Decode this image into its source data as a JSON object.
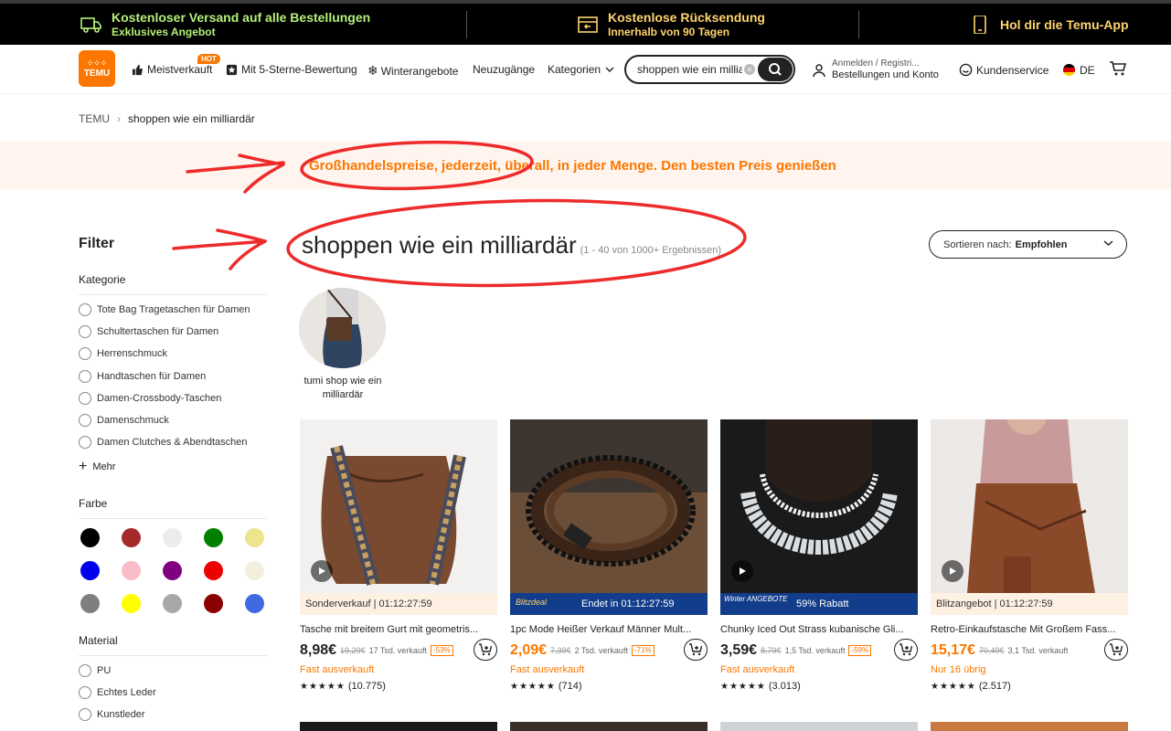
{
  "topbar": {
    "shipping_title": "Kostenloser Versand auf alle Bestellungen",
    "shipping_sub": "Exklusives Angebot",
    "return_title": "Kostenlose Rücksendung",
    "return_sub": "Innerhalb von 90 Tagen",
    "app": "Hol dir die Temu-App"
  },
  "nav": {
    "logo_top": "⁘⁘⁘",
    "logo_text": "TEMU",
    "items": {
      "bestseller": "Meistverkauft",
      "hot": "HOT",
      "fivestar": "Mit 5-Sterne-Bewertung",
      "winter": "Winterangebote",
      "new": "Neuzugänge",
      "categories": "Kategorien"
    },
    "search_value": "shoppen wie ein millia",
    "account_line1": "Anmelden / Registri...",
    "account_line2": "Bestellungen und Konto",
    "service": "Kundenservice",
    "lang": "DE"
  },
  "breadcrumb": {
    "root": "TEMU",
    "sep": "›",
    "current": "shoppen wie ein milliardär"
  },
  "banner": "Großhandelspreise, jederzeit, überall, in jeder Menge. Den besten Preis genießen",
  "filter": {
    "title": "Filter",
    "category_title": "Kategorie",
    "categories": [
      "Tote Bag Tragetaschen für Damen",
      "Schultertaschen für Damen",
      "Herrenschmuck",
      "Handtaschen für Damen",
      "Damen-Crossbody-Taschen",
      "Damenschmuck",
      "Damen Clutches & Abendtaschen"
    ],
    "more": "Mehr",
    "color_title": "Farbe",
    "colors": [
      "#000000",
      "#a52a2a",
      "#ececec",
      "#008000",
      "#ece58e",
      "#0000ee",
      "#f8bcc8",
      "#800080",
      "#ee0000",
      "#f2efdf",
      "#7f7f7f",
      "#ffff00",
      "#a8a8a8",
      "#8b0000",
      "#4169e1"
    ],
    "material_title": "Material",
    "materials": [
      "PU",
      "Echtes Leder",
      "Kunstleder"
    ]
  },
  "results": {
    "query": "shoppen wie ein milliardär",
    "count": "(1 - 40 von 1000+ Ergebnissen)",
    "sort_label": "Sortieren nach:",
    "sort_value": "Empfohlen"
  },
  "related": {
    "label": "tumi shop wie ein milliardär"
  },
  "products": [
    {
      "deal": "Sonderverkauf | 01:12:27:59",
      "title": "Tasche mit breitem Gurt mit geometris...",
      "price": "8,98€",
      "old": "19,29€",
      "sold": "17 Tsd. verkauft",
      "disc": "-53%",
      "status": "Fast ausverkauft",
      "stars": "★★★★★",
      "reviews": "(10.775)"
    },
    {
      "deal_badge": "Blitzdeal",
      "deal": "Endet in 01:12:27:59",
      "title": "1pc Mode Heißer Verkauf Männer Mult...",
      "price": "2,09€",
      "old": "7,39€",
      "sold": "2 Tsd. verkauft",
      "disc": "-71%",
      "status": "Fast ausverkauft",
      "stars": "★★★★★",
      "reviews": "(714)"
    },
    {
      "deal_badge": "Winter ANGEBOTE",
      "deal": "59% Rabatt",
      "title": "Chunky Iced Out Strass kubanische Gli...",
      "price": "3,59€",
      "old": "8,79€",
      "sold": "1,5 Tsd. verkauft",
      "disc": "-59%",
      "status": "Fast ausverkauft",
      "stars": "★★★★★",
      "reviews": "(3.013)"
    },
    {
      "deal": "Blitzangebot | 01:12:27:59",
      "title": "Retro-Einkaufstasche Mit Großem Fass...",
      "price": "15,17€",
      "old": "70,49€",
      "sold": "3,1 Tsd. verkauft",
      "status": "Nur 16 übrig",
      "stars": "★★★★★",
      "reviews": "(2.517)"
    }
  ],
  "accent": "#fb7701"
}
